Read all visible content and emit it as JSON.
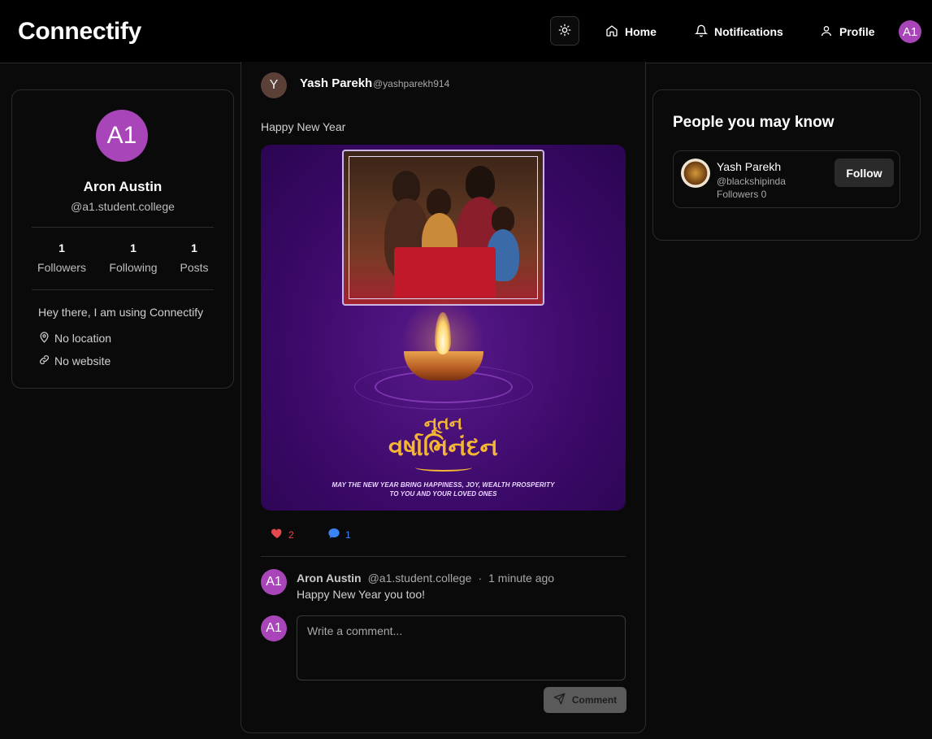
{
  "header": {
    "brand": "Connectify",
    "nav": [
      {
        "label": "Home",
        "icon": "home-icon"
      },
      {
        "label": "Notifications",
        "icon": "bell-icon"
      },
      {
        "label": "Profile",
        "icon": "user-icon"
      }
    ],
    "avatar_initials": "A1"
  },
  "profile": {
    "initials": "A1",
    "name": "Aron Austin",
    "handle": "@a1.student.college",
    "stats": [
      {
        "value": "1",
        "label": "Followers"
      },
      {
        "value": "1",
        "label": "Following"
      },
      {
        "value": "1",
        "label": "Posts"
      }
    ],
    "bio": "Hey there, I am using Connectify",
    "location": "No location",
    "website": "No website"
  },
  "post": {
    "author_initial": "Y",
    "author_name": "Yash Parekh",
    "author_handle": "@yashparekh914",
    "text": "Happy New Year",
    "image": {
      "title_line1": "નૂતન",
      "title_line2": "વર્ષાભિનંદન",
      "tagline_line1": "MAY THE NEW YEAR BRING HAPPINESS, JOY, WEALTH PROSPERITY",
      "tagline_line2": "TO YOU AND YOUR LOVED ONES"
    },
    "likes": "2",
    "comments_count": "1",
    "comments": [
      {
        "initials": "A1",
        "name": "Aron Austin",
        "handle": "@a1.student.college",
        "separator": "·",
        "time": "1 minute ago",
        "text": "Happy New Year you too!"
      }
    ],
    "composer": {
      "initials": "A1",
      "placeholder": "Write a comment...",
      "button_label": "Comment"
    }
  },
  "suggestions": {
    "title": "People you may know",
    "people": [
      {
        "name": "Yash Parekh",
        "handle": "@blackshipinda",
        "followers": "Followers 0",
        "button": "Follow"
      }
    ]
  },
  "colors": {
    "accent_avatar": "#a845b8",
    "like": "#e5484d",
    "comment": "#3b82f6",
    "gold_text": "#f5b733"
  }
}
